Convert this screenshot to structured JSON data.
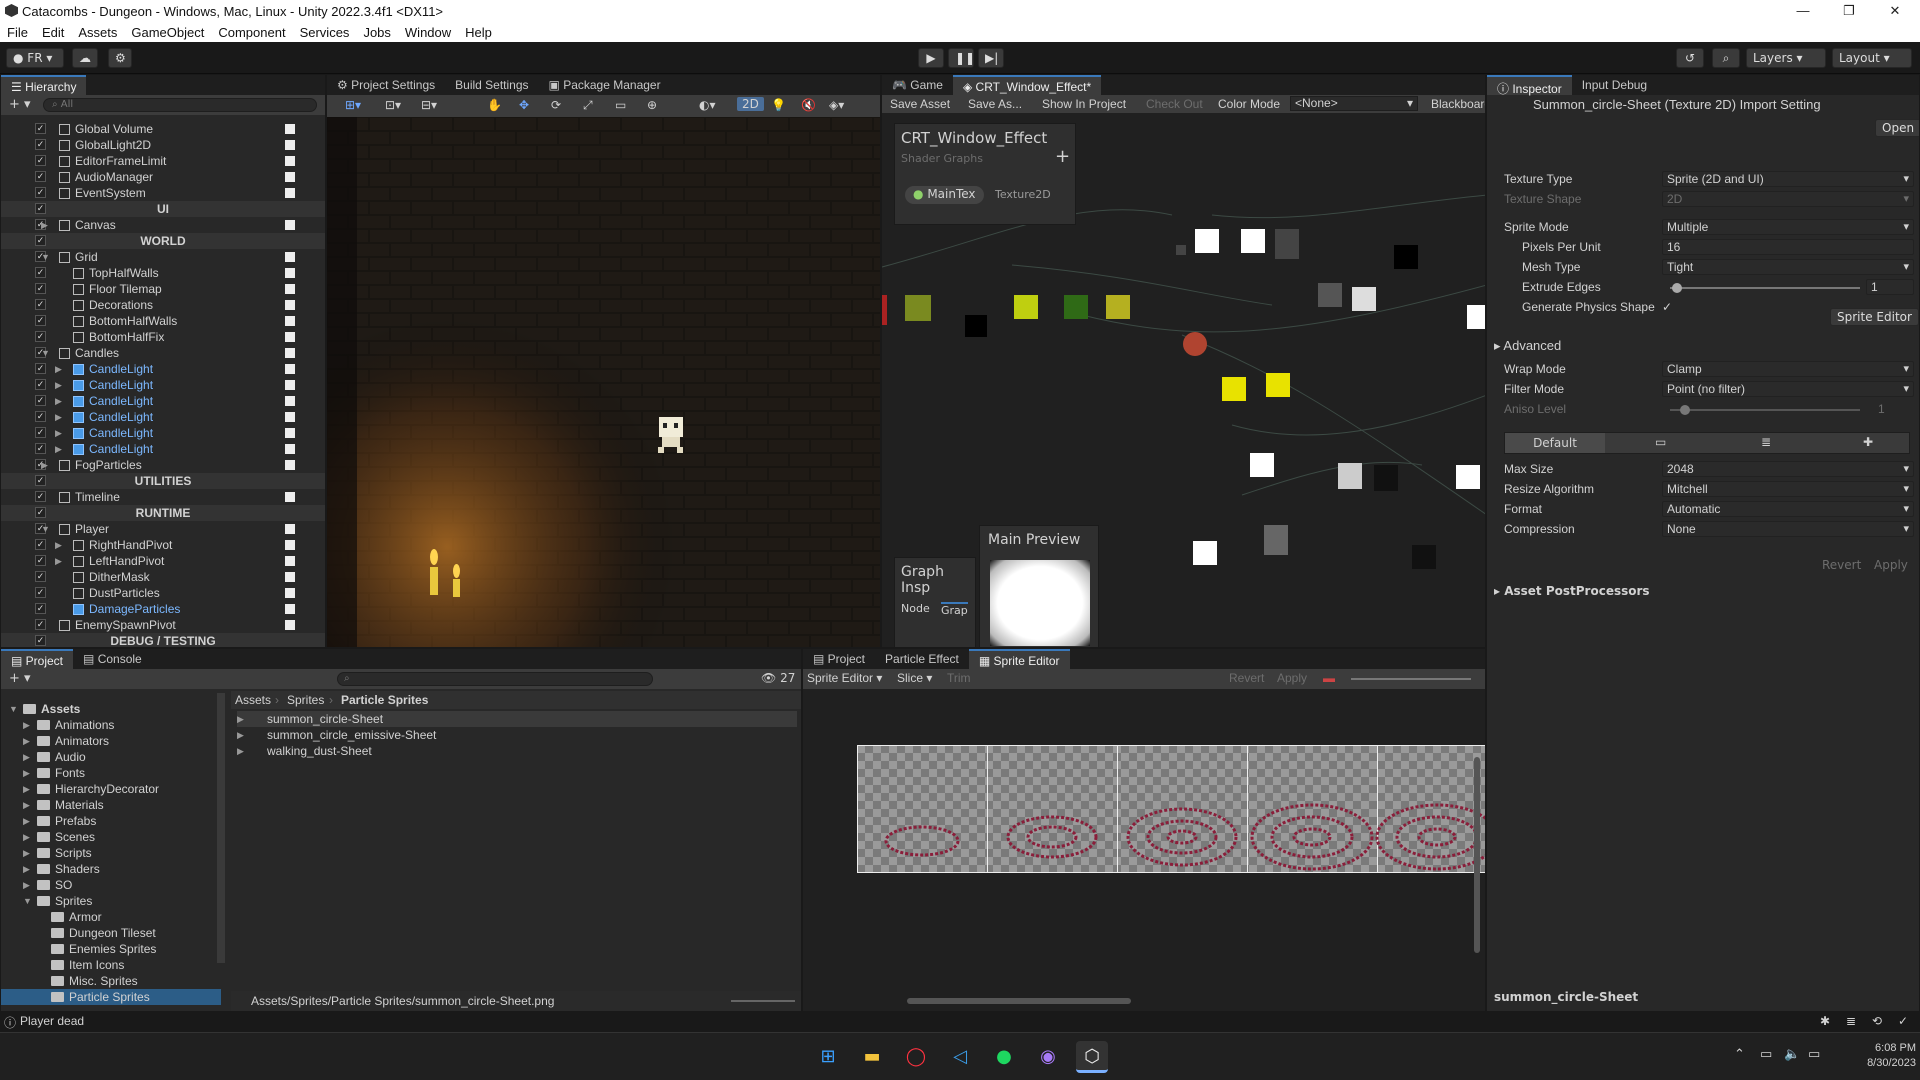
{
  "window": {
    "title": "Catacombs - Dungeon - Windows, Mac, Linux - Unity 2022.3.4f1 <DX11>"
  },
  "menu": [
    "File",
    "Edit",
    "Assets",
    "GameObject",
    "Component",
    "Services",
    "Jobs",
    "Window",
    "Help"
  ],
  "toolbar": {
    "account": "FR",
    "layers": "Layers",
    "layout": "Layout"
  },
  "hierarchy": {
    "tab": "Hierarchy",
    "search_placeholder": "All",
    "rows": [
      {
        "label": "Global Volume",
        "indent": 0,
        "kind": "item"
      },
      {
        "label": "GlobalLight2D",
        "indent": 0,
        "kind": "item"
      },
      {
        "label": "EditorFrameLimit",
        "indent": 0,
        "kind": "item"
      },
      {
        "label": "AudioManager",
        "indent": 0,
        "kind": "item"
      },
      {
        "label": "EventSystem",
        "indent": 0,
        "kind": "item"
      },
      {
        "label": "UI",
        "indent": 0,
        "kind": "header"
      },
      {
        "label": "Canvas",
        "indent": 0,
        "kind": "item",
        "arrow": "▶"
      },
      {
        "label": "WORLD",
        "indent": 0,
        "kind": "header"
      },
      {
        "label": "Grid",
        "indent": 0,
        "kind": "item",
        "arrow": "▼"
      },
      {
        "label": "TopHalfWalls",
        "indent": 1,
        "kind": "item"
      },
      {
        "label": "Floor Tilemap",
        "indent": 1,
        "kind": "item"
      },
      {
        "label": "Decorations",
        "indent": 1,
        "kind": "item"
      },
      {
        "label": "BottomHalfWalls",
        "indent": 1,
        "kind": "item"
      },
      {
        "label": "BottomHalfFix",
        "indent": 1,
        "kind": "item"
      },
      {
        "label": "Candles",
        "indent": 0,
        "kind": "item",
        "arrow": "▼"
      },
      {
        "label": "CandleLight",
        "indent": 1,
        "kind": "prefab",
        "arrow": "▶"
      },
      {
        "label": "CandleLight",
        "indent": 1,
        "kind": "prefab",
        "arrow": "▶"
      },
      {
        "label": "CandleLight",
        "indent": 1,
        "kind": "prefab",
        "arrow": "▶"
      },
      {
        "label": "CandleLight",
        "indent": 1,
        "kind": "prefab",
        "arrow": "▶"
      },
      {
        "label": "CandleLight",
        "indent": 1,
        "kind": "prefab",
        "arrow": "▶"
      },
      {
        "label": "CandleLight",
        "indent": 1,
        "kind": "prefab",
        "arrow": "▶"
      },
      {
        "label": "FogParticles",
        "indent": 0,
        "kind": "item",
        "arrow": "▶"
      },
      {
        "label": "UTILITIES",
        "indent": 0,
        "kind": "header"
      },
      {
        "label": "Timeline",
        "indent": 0,
        "kind": "item"
      },
      {
        "label": "RUNTIME",
        "indent": 0,
        "kind": "header"
      },
      {
        "label": "Player",
        "indent": 0,
        "kind": "item",
        "arrow": "▼"
      },
      {
        "label": "RightHandPivot",
        "indent": 1,
        "kind": "item",
        "arrow": "▶"
      },
      {
        "label": "LeftHandPivot",
        "indent": 1,
        "kind": "item",
        "arrow": "▶"
      },
      {
        "label": "DitherMask",
        "indent": 1,
        "kind": "item"
      },
      {
        "label": "DustParticles",
        "indent": 1,
        "kind": "item"
      },
      {
        "label": "DamageParticles",
        "indent": 1,
        "kind": "prefab"
      },
      {
        "label": "EnemySpawnPivot",
        "indent": 0,
        "kind": "item"
      },
      {
        "label": "DEBUG / TESTING",
        "indent": 0,
        "kind": "header"
      }
    ]
  },
  "scene_tabs": {
    "project_settings": "Project Settings",
    "build_settings": "Build Settings",
    "package_manager": "Package Manager",
    "mode2d": "2D"
  },
  "shader_graph": {
    "tabs": [
      "Game",
      "CRT_Window_Effect*"
    ],
    "toolbar": [
      "Save Asset",
      "Save As...",
      "Show In Project",
      "Check Out",
      "Color Mode"
    ],
    "color_mode_value": "<None>",
    "blackboard": "Blackboard",
    "bb_title": "CRT_Window_Effect",
    "bb_subtitle": "Shader Graphs",
    "property_name": "MainTex",
    "property_type": "Texture2D",
    "graph_inspector": "Graph Insp",
    "gi_tabs": [
      "Node",
      "Grap"
    ],
    "main_preview": "Main Preview"
  },
  "inspector": {
    "tabs": [
      "Inspector",
      "Input Debug"
    ],
    "title": "Summon_circle-Sheet (Texture 2D) Import Setting",
    "open": "Open",
    "rows": [
      {
        "k": "Texture Type",
        "v": "Sprite (2D and UI)",
        "dd": true,
        "dim": false
      },
      {
        "k": "Texture Shape",
        "v": "2D",
        "dd": true,
        "dim": true
      },
      {
        "k": "Sprite Mode",
        "v": "Multiple",
        "dd": true,
        "dim": false
      },
      {
        "k": "Pixels Per Unit",
        "v": "16",
        "dd": false,
        "dim": false,
        "indent": true
      },
      {
        "k": "Mesh Type",
        "v": "Tight",
        "dd": true,
        "dim": false,
        "indent": true
      }
    ],
    "extrude_edges": {
      "k": "Extrude Edges",
      "v": "1"
    },
    "physics_shape": "Generate Physics Shape",
    "sprite_editor": "Sprite Editor",
    "advanced": "Advanced",
    "rows2": [
      {
        "k": "Wrap Mode",
        "v": "Clamp"
      },
      {
        "k": "Filter Mode",
        "v": "Point (no filter)"
      }
    ],
    "aniso": {
      "k": "Aniso Level",
      "v": "1"
    },
    "platform_default": "Default",
    "rows3": [
      {
        "k": "Max Size",
        "v": "2048"
      },
      {
        "k": "Resize Algorithm",
        "v": "Mitchell"
      },
      {
        "k": "Format",
        "v": "Automatic"
      },
      {
        "k": "Compression",
        "v": "None"
      }
    ],
    "revert": "Revert",
    "apply": "Apply",
    "postprocessors": "Asset PostProcessors",
    "footer": "summon_circle-Sheet"
  },
  "project": {
    "tabs": [
      "Project",
      "Console"
    ],
    "count": "27",
    "breadcrumb": [
      "Assets",
      "Sprites",
      "Particle Sprites"
    ],
    "tree": [
      {
        "label": "Assets",
        "depth": 0,
        "open": true,
        "bold": true
      },
      {
        "label": "Animations",
        "depth": 1
      },
      {
        "label": "Animators",
        "depth": 1
      },
      {
        "label": "Audio",
        "depth": 1
      },
      {
        "label": "Fonts",
        "depth": 1
      },
      {
        "label": "HierarchyDecorator",
        "depth": 1
      },
      {
        "label": "Materials",
        "depth": 1
      },
      {
        "label": "Prefabs",
        "depth": 1
      },
      {
        "label": "Scenes",
        "depth": 1
      },
      {
        "label": "Scripts",
        "depth": 1
      },
      {
        "label": "Shaders",
        "depth": 1
      },
      {
        "label": "SO",
        "depth": 1
      },
      {
        "label": "Sprites",
        "depth": 1,
        "open": true
      },
      {
        "label": "Armor",
        "depth": 2
      },
      {
        "label": "Dungeon Tileset",
        "depth": 2
      },
      {
        "label": "Enemies Sprites",
        "depth": 2
      },
      {
        "label": "Item Icons",
        "depth": 2
      },
      {
        "label": "Misc. Sprites",
        "depth": 2
      },
      {
        "label": "Particle Sprites",
        "depth": 2,
        "selected": true
      }
    ],
    "files": [
      "summon_circle-Sheet",
      "summon_circle_emissive-Sheet",
      "walking_dust-Sheet"
    ],
    "path": "Assets/Sprites/Particle Sprites/summon_circle-Sheet.png"
  },
  "sprite_editor": {
    "tabs": [
      "Project",
      "Particle Effect",
      "Sprite Editor"
    ],
    "toolbar": [
      "Sprite Editor",
      "Slice",
      "Trim"
    ],
    "revert": "Revert",
    "apply": "Apply"
  },
  "status": {
    "message": "Player dead"
  },
  "taskbar": {
    "time": "6:08 PM",
    "date": "8/30/2023"
  }
}
